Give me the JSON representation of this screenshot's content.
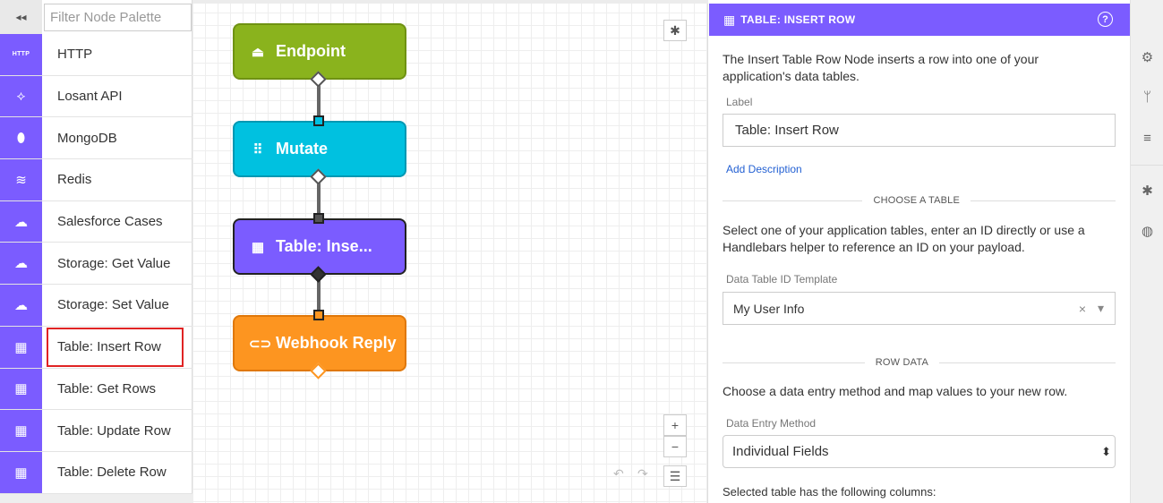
{
  "palette": {
    "collapse_glyph": "◂◂",
    "filter_placeholder": "Filter Node Palette",
    "items": [
      {
        "label": "HTTP",
        "icon": "http-icon",
        "glyph": "HTTP"
      },
      {
        "label": "Losant API",
        "icon": "losant-icon",
        "glyph": "⟡"
      },
      {
        "label": "MongoDB",
        "icon": "mongodb-leaf-icon",
        "glyph": "⬮"
      },
      {
        "label": "Redis",
        "icon": "redis-stack-icon",
        "glyph": "≋"
      },
      {
        "label": "Salesforce Cases",
        "icon": "salesforce-cloud-icon",
        "glyph": "☁"
      },
      {
        "label": "Storage: Get Value",
        "icon": "cloud-download-icon",
        "glyph": "☁"
      },
      {
        "label": "Storage: Set Value",
        "icon": "cloud-upload-icon",
        "glyph": "☁"
      },
      {
        "label": "Table: Insert Row",
        "icon": "table-insert-icon",
        "glyph": "▦"
      },
      {
        "label": "Table: Get Rows",
        "icon": "table-get-icon",
        "glyph": "▦"
      },
      {
        "label": "Table: Update Row",
        "icon": "table-update-icon",
        "glyph": "▦"
      },
      {
        "label": "Table: Delete Row",
        "icon": "table-delete-icon",
        "glyph": "▦"
      }
    ],
    "selected": "Table: Insert Row"
  },
  "canvas": {
    "nodes": [
      {
        "label": "Endpoint",
        "color": "#8ab31d",
        "border": "#6f9212",
        "icon": "endpoint-icon",
        "glyph": "⏏"
      },
      {
        "label": "Mutate",
        "color": "#00c1e0",
        "border": "#0098b3",
        "icon": "mutate-icon",
        "glyph": "⠿"
      },
      {
        "label": "Table: Inse...",
        "color": "#7b5cff",
        "border": "#222222",
        "icon": "table-icon",
        "glyph": "▦"
      },
      {
        "label": "Webhook Reply",
        "color": "#fd9520",
        "border": "#e0780a",
        "icon": "link-icon",
        "glyph": "⊂⊃"
      }
    ],
    "debug_glyph": "✱",
    "zoom_in": "+",
    "zoom_out": "−",
    "menu_glyph": "☰",
    "undo_glyph": "↶",
    "redo_glyph": "↷"
  },
  "props": {
    "header_title": "TABLE: INSERT ROW",
    "help_glyph": "?",
    "description": "The Insert Table Row Node inserts a row into one of your application's data tables.",
    "label_caption": "Label",
    "label_value": "Table: Insert Row",
    "add_description": "Add Description",
    "choose_table_title": "CHOOSE A TABLE",
    "choose_table_text": "Select one of your application tables, enter an ID directly or use a Handlebars helper to reference an ID on your payload.",
    "table_id_caption": "Data Table ID Template",
    "table_id_value": "My User Info",
    "clear_glyph": "×",
    "caret_glyph": "▾",
    "row_data_title": "ROW DATA",
    "row_data_text": "Choose a data entry method and map values to your new row.",
    "entry_method_caption": "Data Entry Method",
    "entry_method_value": "Individual Fields",
    "select_arrows": "⬍",
    "columns_text": "Selected table has the following columns:"
  },
  "rail": {
    "items": [
      {
        "icon": "gear-icon",
        "glyph": "⚙"
      },
      {
        "icon": "branch-icon",
        "glyph": "ᛘ"
      },
      {
        "icon": "database-icon",
        "glyph": "≡"
      },
      {
        "icon": "debug-icon",
        "glyph": "✱"
      },
      {
        "icon": "globe-icon",
        "glyph": "◍"
      }
    ]
  },
  "colors": {
    "accent": "#7b5cff",
    "selection_outline": "#e02424",
    "link": "#2461d3"
  }
}
